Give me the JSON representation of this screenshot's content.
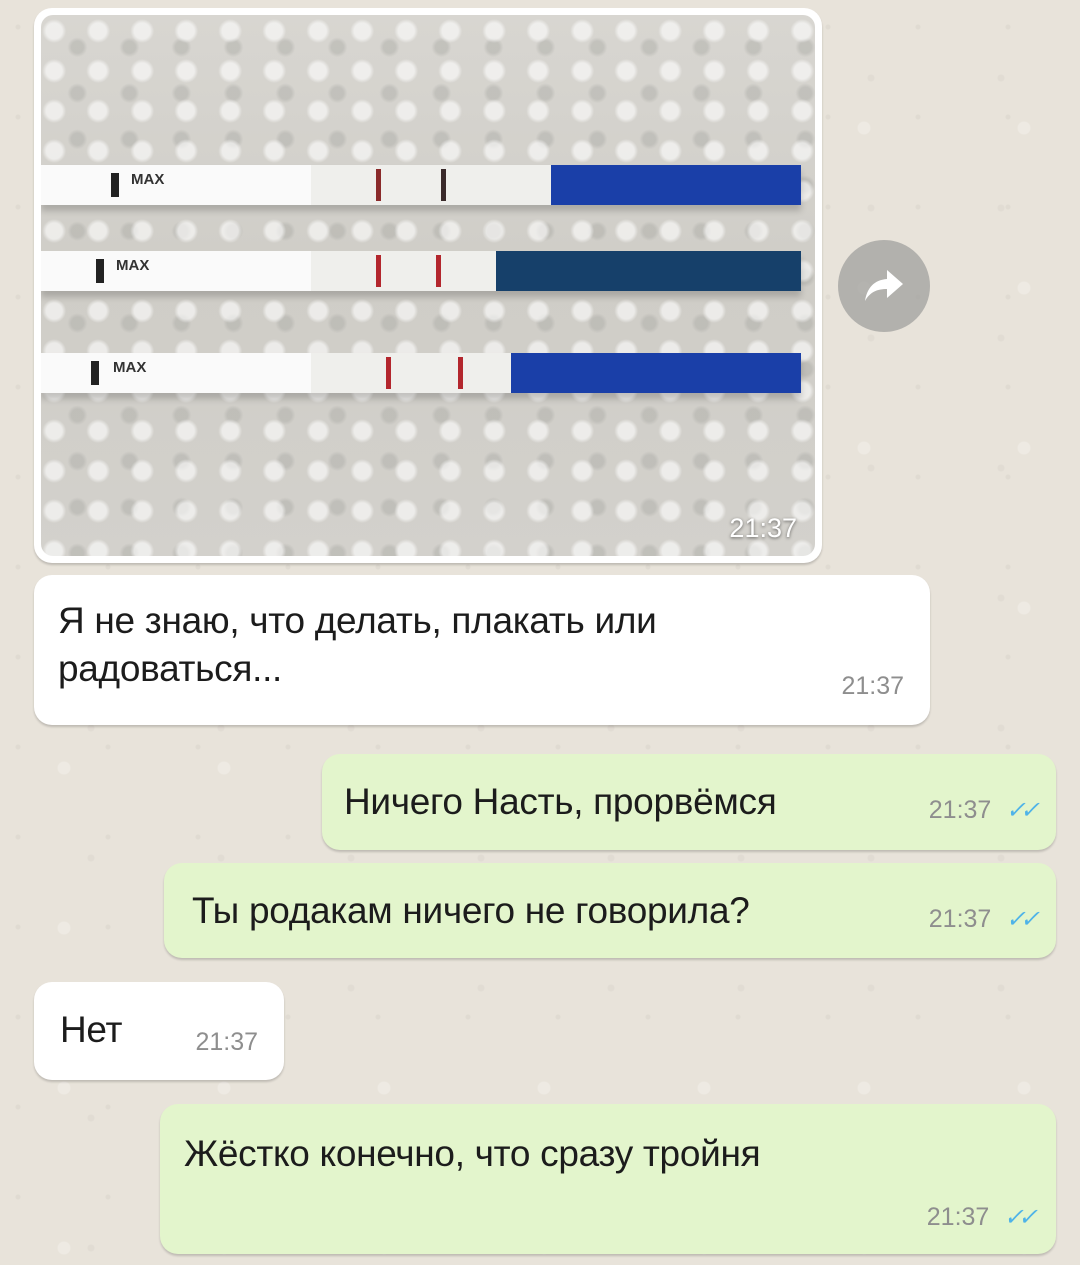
{
  "chat": {
    "image_message": {
      "time": "21:37",
      "strip_labels": [
        "MAX",
        "MAX",
        "MAX"
      ]
    },
    "messages": [
      {
        "direction": "incoming",
        "text_line1": "Я не знаю, что делать, плакать или",
        "text_line2": "радоваться...",
        "time": "21:37"
      },
      {
        "direction": "outgoing",
        "text": "Ничего Насть, прорвёмся",
        "time": "21:37",
        "ticks": "✓✓"
      },
      {
        "direction": "outgoing",
        "text": "Ты родакам ничего не говорила?",
        "time": "21:37",
        "ticks": "✓✓"
      },
      {
        "direction": "incoming",
        "text": "Нет",
        "time": "21:37"
      },
      {
        "direction": "outgoing",
        "text": "Жёстко конечно, что сразу тройня",
        "time": "21:37",
        "ticks": "✓✓"
      }
    ]
  },
  "icons": {
    "forward": "forward-arrow-icon",
    "read_receipt": "double-check-icon"
  },
  "colors": {
    "wallpaper": "#e8e3da",
    "incoming_bubble": "#ffffff",
    "outgoing_bubble": "#e3f5cc",
    "read_ticks": "#4fb3e8",
    "test_strip_blue": "#1a3fa8"
  }
}
